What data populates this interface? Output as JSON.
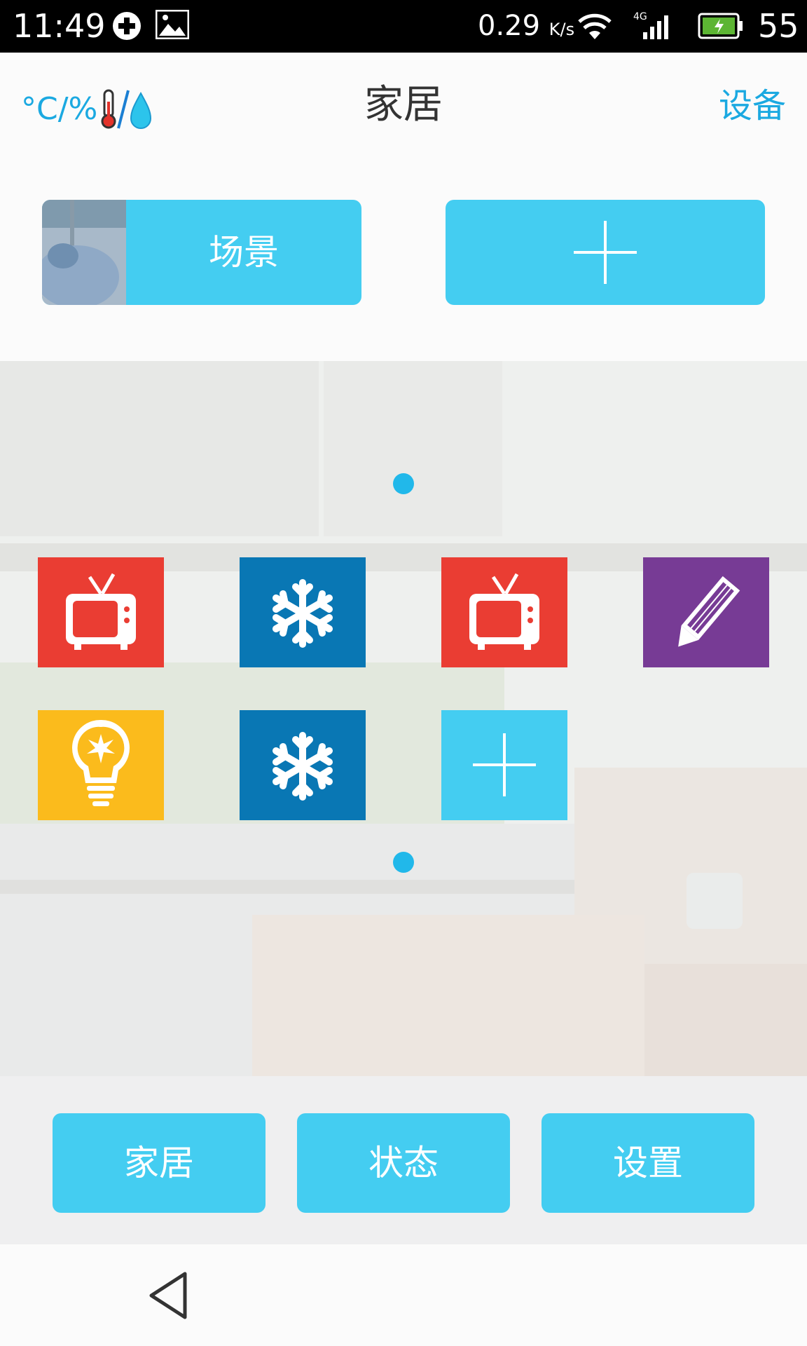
{
  "status_bar": {
    "time": "11:49",
    "net_speed": "0.29",
    "net_unit": "K/s",
    "network_type": "4G",
    "battery": "55"
  },
  "header": {
    "unit_toggle": "°C/%",
    "title": "家居",
    "device_link": "设备"
  },
  "scene": {
    "label": "场景"
  },
  "tiles": [
    {
      "icon": "tv-icon",
      "color": "#ea3d33"
    },
    {
      "icon": "snowflake-icon",
      "color": "#0977b4"
    },
    {
      "icon": "tv-icon",
      "color": "#ea3d33"
    },
    {
      "icon": "pencil-icon",
      "color": "#773b95"
    },
    {
      "icon": "lightbulb-icon",
      "color": "#fbbb1c"
    },
    {
      "icon": "snowflake-icon",
      "color": "#0977b4"
    },
    {
      "icon": "plus-icon",
      "color": "#44cdf1"
    }
  ],
  "nav": {
    "home": "家居",
    "status": "状态",
    "settings": "设置"
  },
  "colors": {
    "accent": "#44cdf1",
    "accent_text": "#1ba9e1"
  }
}
